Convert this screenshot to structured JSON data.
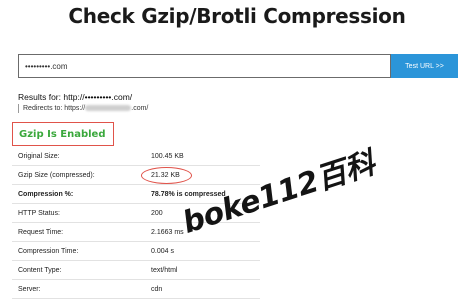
{
  "title": "Check Gzip/Brotli Compression",
  "search": {
    "value": "•••••••••.com",
    "button_label": "Test URL >>"
  },
  "results": {
    "results_for": "Results for: http://•••••••••.com/",
    "redirect_prefix": "Redirects to: https://",
    "redirect_suffix": ".com/"
  },
  "gzip_status": "Gzip Is Enabled",
  "table": [
    {
      "label": "Original Size:",
      "value": "100.45 KB"
    },
    {
      "label": "Gzip Size (compressed):",
      "value": "21.32 KB"
    },
    {
      "label": "Compression %:",
      "value": "78.78% is compressed"
    },
    {
      "label": "HTTP Status:",
      "value": "200"
    },
    {
      "label": "Request Time:",
      "value": "2.1663 ms"
    },
    {
      "label": "Compression Time:",
      "value": "0.004 s"
    },
    {
      "label": "Content Type:",
      "value": "text/html"
    },
    {
      "label": "Server:",
      "value": "cdn"
    }
  ],
  "watermark": "boke112百科",
  "colors": {
    "accent": "#2b95d9",
    "success": "#3aa83c",
    "annotation": "#e0534a"
  }
}
